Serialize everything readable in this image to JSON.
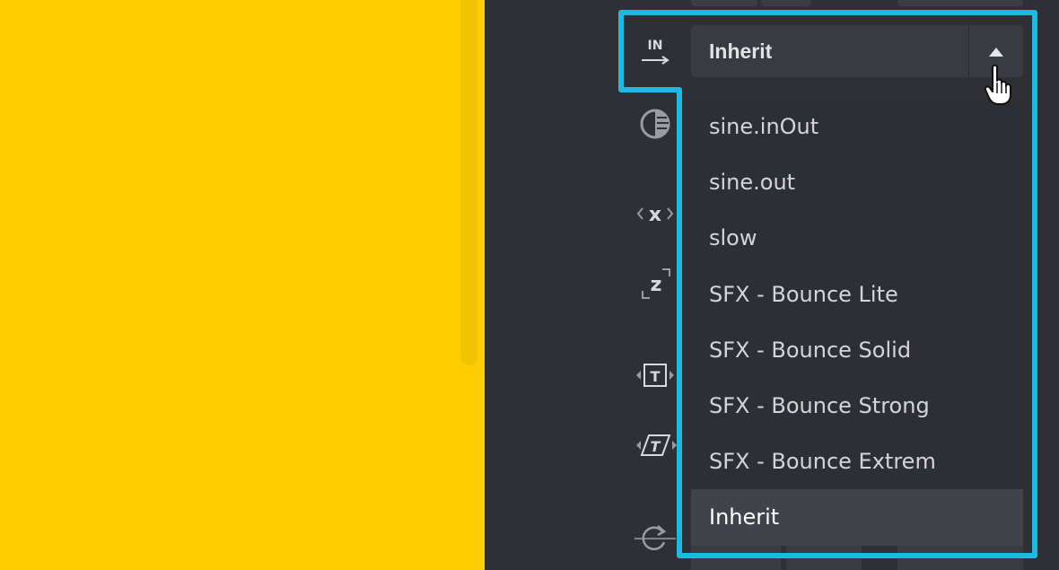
{
  "easing_select": {
    "value": "Inherit",
    "options": [
      {
        "label": "sine.inOut"
      },
      {
        "label": "sine.out"
      },
      {
        "label": "slow"
      },
      {
        "label": "SFX - Bounce Lite"
      },
      {
        "label": "SFX - Bounce Solid"
      },
      {
        "label": "SFX - Bounce Strong"
      },
      {
        "label": "SFX - Bounce Extrem"
      },
      {
        "label": "Inherit"
      }
    ],
    "selected_index": 7
  },
  "icons": {
    "in_label": "IN",
    "x_label": "x",
    "z_label": "z",
    "t_label": "T"
  },
  "colors": {
    "canvas": "#ffcd00",
    "panel": "#2f3035",
    "highlight": "#1fb8e0"
  }
}
